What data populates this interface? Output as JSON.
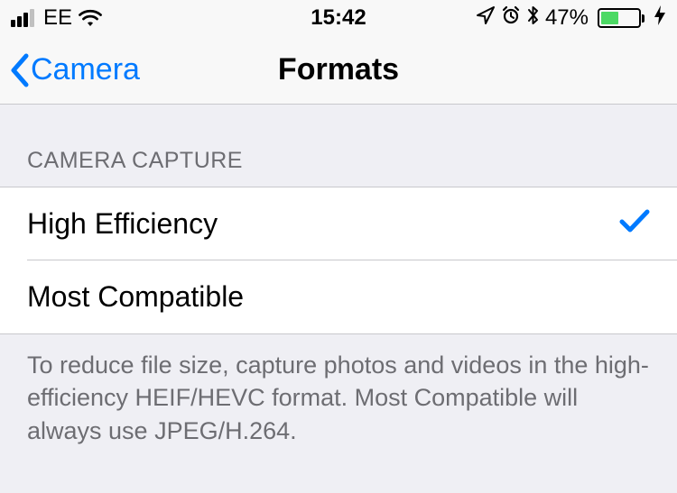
{
  "status_bar": {
    "carrier": "EE",
    "time": "15:42",
    "battery_percent": "47%"
  },
  "nav": {
    "back_label": "Camera",
    "title": "Formats"
  },
  "section": {
    "header": "CAMERA CAPTURE",
    "options": [
      {
        "label": "High Efficiency",
        "selected": true
      },
      {
        "label": "Most Compatible",
        "selected": false
      }
    ],
    "footer": "To reduce file size, capture photos and videos in the high-efficiency HEIF/HEVC format. Most Compatible will always use JPEG/H.264."
  }
}
